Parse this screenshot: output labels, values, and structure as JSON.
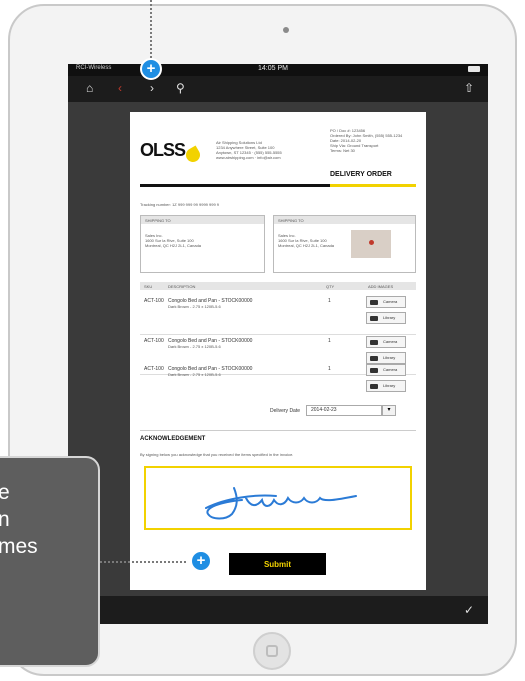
{
  "status_bar": {
    "carrier": "RCI-Wireless",
    "time": "14:05 PM"
  },
  "document": {
    "logo": "OLSS",
    "company_lines": [
      "Air Shipping Solutions Ltd",
      "1234 Anywhere Street, Suite 100",
      "Anytown, ST 12345 · (555) 555-5555",
      "",
      "www.airshipping.com · info@air.com"
    ],
    "order_meta": [
      "PO / Doc #: 123456",
      "Ordered By: John Smith, (555) 555-1234",
      "Date: 2014-02-20",
      "Ship Via: Ground Transport",
      "Terms: Net 30"
    ],
    "doc_title": "DELIVERY ORDER",
    "tracking_line": "Tracking number: 1Z 999 999 99 9999 999 9",
    "ship_from": {
      "header": "SHIPPING TO",
      "lines": [
        "Sales Inc.",
        "1600 Sur la Rive, Suite 100",
        "Montreal, QC H2J 2L1, Canada"
      ]
    },
    "ship_to": {
      "header": "SHIPPING TO",
      "lines": [
        "Sales Inc.",
        "1600 Sur la Rive, Suite 100",
        "Montreal, QC H2J 2L1, Canada"
      ]
    },
    "table_headers": {
      "sku": "SKU",
      "description": "DESCRIPTION",
      "qty": "QTY",
      "add_images": "ADD IMAGES"
    },
    "rows": [
      {
        "sku": "ACT-100",
        "description": "Congolo Bed and Pan - STOCK00000",
        "sub": "Dark Brown - 2.75 x 120B-5.6",
        "qty": "1"
      },
      {
        "sku": "ACT-100",
        "description": "Congolo Bed and Pan - STOCK00000",
        "sub": "Dark Brown - 2.75 x 120B-5.6",
        "qty": "1"
      },
      {
        "sku": "ACT-100",
        "description": "Congolo Bed and Pan - STOCK00000",
        "sub": "Dark Brown - 2.75 x 120B-5.6",
        "qty": "1"
      }
    ],
    "camera_label": "Camera",
    "library_label": "Library",
    "delivery_date_label": "Delivery Date",
    "delivery_date_value": "2014-02-23",
    "ack_title": "ACKNOWLEDGEMENT",
    "ack_text": "By signing below you acknowledge that you received the items specified in the invoice."
  },
  "callout": {
    "lines": [
      "e",
      "n",
      "mes"
    ]
  },
  "submit_label": "Submit",
  "colors": {
    "accent": "#f2d200",
    "plus": "#1f8ee3",
    "callout": "#5e5e5e"
  },
  "icons": {
    "home": "home-icon",
    "back": "back-arrow-icon",
    "forward": "forward-arrow-icon",
    "search": "search-icon",
    "share": "share-icon",
    "wrench": "wrench-icon",
    "plus": "plus-icon"
  }
}
